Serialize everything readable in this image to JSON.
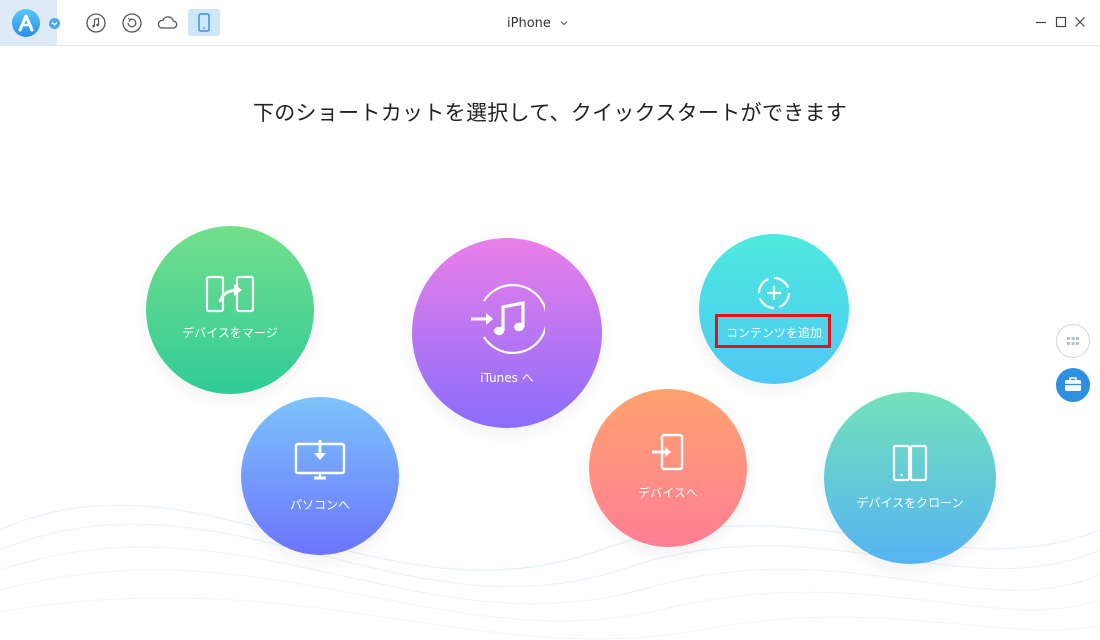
{
  "app": {
    "logo_icon": "anytrans-logo-icon",
    "logo_menu_icon": "chevron-down-icon",
    "toolbar": [
      {
        "name": "music-icon"
      },
      {
        "name": "backup-icon"
      },
      {
        "name": "cloud-icon"
      },
      {
        "name": "phone-icon",
        "active": true
      }
    ],
    "device_selector": {
      "label": "iPhone",
      "icon": "chevron-down-icon"
    },
    "window_controls": [
      "minimize-icon",
      "maximize-icon",
      "close-icon"
    ]
  },
  "main": {
    "heading": "下のショートカットを選択して、クイックスタートができます",
    "shortcuts": {
      "merge": {
        "label": "デバイスをマージ",
        "icon": "merge-devices-icon"
      },
      "itunes": {
        "label": "iTunes へ",
        "icon": "itunes-transfer-icon"
      },
      "add_content": {
        "label": "コンテンツを追加",
        "icon": "add-content-icon",
        "highlighted": true
      },
      "to_pc": {
        "label": "パソコンへ",
        "icon": "computer-download-icon"
      },
      "to_device": {
        "label": "デバイスへ",
        "icon": "phone-import-icon"
      },
      "clone": {
        "label": "デバイスをクローン",
        "icon": "clone-device-icon"
      }
    }
  },
  "side": {
    "buttons": [
      "apps-grid-icon",
      "toolbox-icon"
    ]
  },
  "colors": {
    "accent": "#2f8fe0",
    "highlight": "#e01414",
    "merge": [
      "#74df8c",
      "#2fcb97"
    ],
    "itunes": [
      "#ea7fe8",
      "#8a6dfb"
    ],
    "add_content": [
      "#4deadd",
      "#4ec8f4"
    ],
    "to_pc": [
      "#7cc4fb",
      "#6c74fb"
    ],
    "to_device": [
      "#ffa26e",
      "#ff7e94"
    ],
    "clone": [
      "#72e2b9",
      "#56b3f3"
    ]
  }
}
